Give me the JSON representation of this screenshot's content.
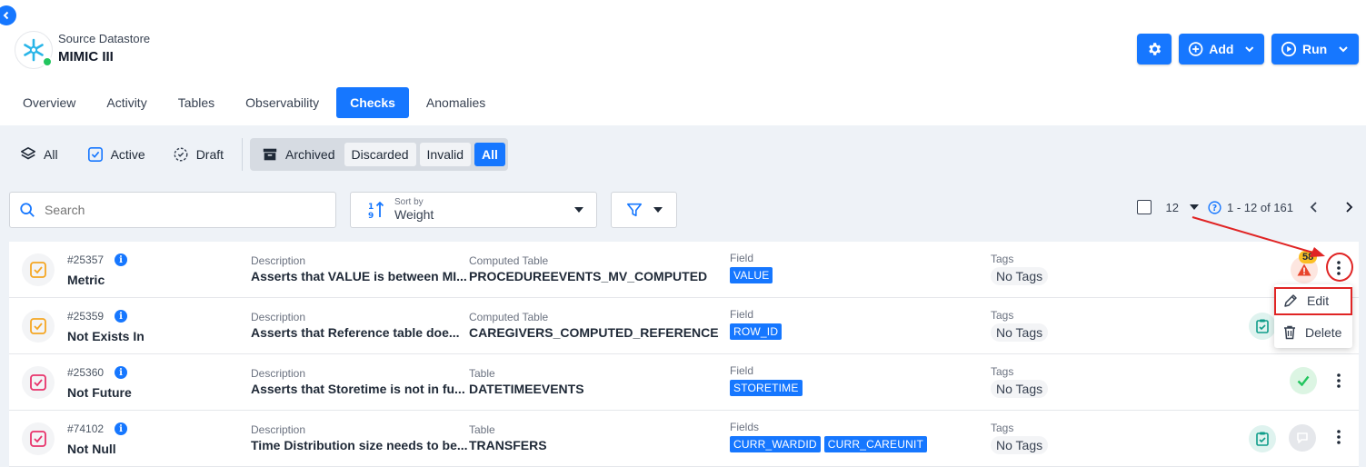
{
  "header": {
    "subtitle": "Source Datastore",
    "title": "MIMIC III",
    "add_label": "Add",
    "run_label": "Run"
  },
  "tabs": [
    {
      "label": "Overview"
    },
    {
      "label": "Activity"
    },
    {
      "label": "Tables"
    },
    {
      "label": "Observability"
    },
    {
      "label": "Checks",
      "active": true
    },
    {
      "label": "Anomalies"
    }
  ],
  "status_filters": {
    "all": "All",
    "active": "Active",
    "draft": "Draft",
    "archived": "Archived",
    "discarded": "Discarded",
    "invalid": "Invalid",
    "archived_all": "All"
  },
  "toolbar": {
    "search_placeholder": "Search",
    "sort_caption": "Sort by",
    "sort_value": "Weight"
  },
  "pager": {
    "page_size": "12",
    "range": "1 - 12 of 161"
  },
  "checks": [
    {
      "id": "#25357",
      "name": "Metric",
      "desc_label": "Description",
      "desc": "Asserts that VALUE is between MI...",
      "table_label": "Computed Table",
      "table": "PROCEDUREEVENTS_MV_COMPUTED",
      "field_label": "Field",
      "fields": [
        "VALUE"
      ],
      "tags_label": "Tags",
      "tags": "No Tags",
      "anomaly_count": "58"
    },
    {
      "id": "#25359",
      "name": "Not Exists In",
      "desc_label": "Description",
      "desc": "Asserts that Reference table doe...",
      "table_label": "Computed Table",
      "table": "CAREGIVERS_COMPUTED_REFERENCE",
      "field_label": "Field",
      "fields": [
        "ROW_ID"
      ],
      "tags_label": "Tags",
      "tags": "No Tags"
    },
    {
      "id": "#25360",
      "name": "Not Future",
      "desc_label": "Description",
      "desc": "Asserts that Storetime is not in fu...",
      "table_label": "Table",
      "table": "DATETIMEEVENTS",
      "field_label": "Field",
      "fields": [
        "STORETIME"
      ],
      "tags_label": "Tags",
      "tags": "No Tags"
    },
    {
      "id": "#74102",
      "name": "Not Null",
      "desc_label": "Description",
      "desc": "Time Distribution size needs to be...",
      "table_label": "Table",
      "table": "TRANSFERS",
      "field_label": "Fields",
      "fields": [
        "CURR_WARDID",
        "CURR_CAREUNIT"
      ],
      "tags_label": "Tags",
      "tags": "No Tags"
    }
  ],
  "context_menu": {
    "edit": "Edit",
    "delete": "Delete"
  },
  "colors": {
    "accent": "#1677ff",
    "highlight_red": "#e02424",
    "row_icon_orange": "#f5a623",
    "row_icon_pink": "#e8336b",
    "success_green": "#22c55e",
    "status_teal": "#0f9d8a"
  }
}
